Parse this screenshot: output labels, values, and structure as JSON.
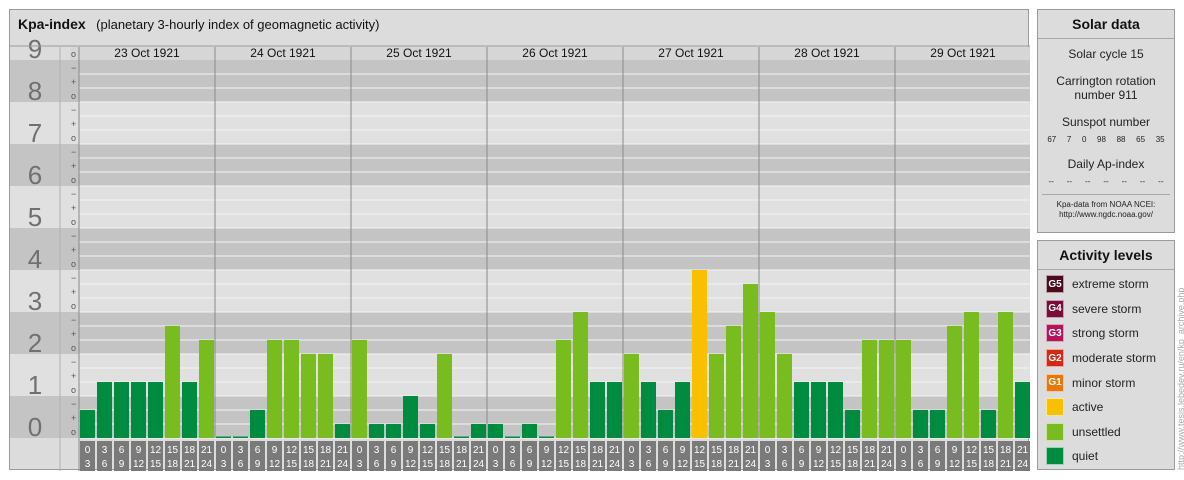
{
  "header": {
    "title": "Kpa-index",
    "subtitle": "(planetary 3-hourly index of geomagnetic activity)"
  },
  "chart_data": {
    "type": "bar",
    "title": "Kpa-index",
    "subtitle": "(planetary 3-hourly index of geomagnetic activity)",
    "ylim": [
      0,
      9
    ],
    "y_ticks": [
      "0",
      "1",
      "2",
      "3",
      "4",
      "5",
      "6",
      "7",
      "8",
      "9"
    ],
    "sub_ticks": [
      "o",
      "+",
      "−"
    ],
    "days": [
      "23 Oct 1921",
      "24 Oct 1921",
      "25 Oct 1921",
      "26 Oct 1921",
      "27 Oct 1921",
      "28 Oct 1921",
      "29 Oct 1921"
    ],
    "hour_start": [
      "0",
      "3",
      "6",
      "9",
      "12",
      "15",
      "18",
      "21"
    ],
    "hour_end": [
      "3",
      "6",
      "9",
      "12",
      "15",
      "18",
      "21",
      "24"
    ],
    "values": [
      [
        0.667,
        1.333,
        1.333,
        1.333,
        1.333,
        2.667,
        1.333,
        2.333
      ],
      [
        0.0,
        0.0,
        0.667,
        2.333,
        2.333,
        2.0,
        2.0,
        0.333
      ],
      [
        2.333,
        0.333,
        0.333,
        1.0,
        0.333,
        2.0,
        0.0,
        0.333
      ],
      [
        0.333,
        0.0,
        0.333,
        0.0,
        2.333,
        3.0,
        1.333,
        1.333
      ],
      [
        2.0,
        1.333,
        0.667,
        1.333,
        4.0,
        2.0,
        2.667,
        3.667
      ],
      [
        3.0,
        2.0,
        1.333,
        1.333,
        1.333,
        0.667,
        2.333,
        2.333
      ],
      [
        2.333,
        0.667,
        0.667,
        2.667,
        3.0,
        0.667,
        3.0,
        1.333
      ]
    ],
    "level_colors": {
      "quiet": "#008c40",
      "unsettled": "#78bc20",
      "active": "#f8c000"
    },
    "grid": true
  },
  "solar": {
    "title": "Solar data",
    "cycle": "Solar cycle 15",
    "carrington_line1": "Carrington rotation",
    "carrington_line2": "number 911",
    "sunspot_title": "Sunspot number",
    "sunspot_values": [
      "67",
      "7",
      "0",
      "98",
      "88",
      "65",
      "35"
    ],
    "ap_title": "Daily Ap-index",
    "ap_values": [
      "--",
      "--",
      "--",
      "--",
      "--",
      "--",
      "--"
    ],
    "note_line1": "Kpa-data from NOAA NCEI:",
    "note_line2": "http://www.ngdc.noaa.gov/"
  },
  "activity": {
    "title": "Activity levels",
    "levels": [
      {
        "badge": "G5",
        "label": "extreme storm",
        "color": "#4b0a1e"
      },
      {
        "badge": "G4",
        "label": "severe storm",
        "color": "#7a0c3c"
      },
      {
        "badge": "G3",
        "label": "strong storm",
        "color": "#b4145a"
      },
      {
        "badge": "G2",
        "label": "moderate storm",
        "color": "#d22814"
      },
      {
        "badge": "G1",
        "label": "minor storm",
        "color": "#e6780a"
      },
      {
        "badge": "",
        "label": "active",
        "color": "#f8c000"
      },
      {
        "badge": "",
        "label": "unsettled",
        "color": "#78bc20"
      },
      {
        "badge": "",
        "label": "quiet",
        "color": "#008c40"
      }
    ]
  },
  "watermark": "http://www.tesis.lebedev.ru/en/kp_archive.php"
}
